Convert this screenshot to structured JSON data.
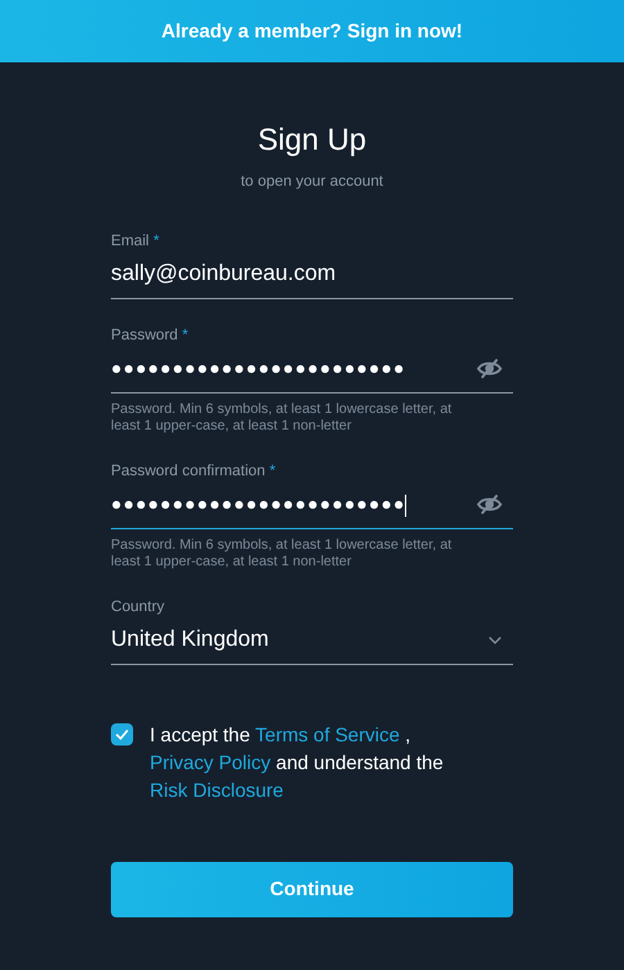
{
  "banner": {
    "text": "Already a member?",
    "link": "Sign in now!"
  },
  "title": "Sign Up",
  "subtitle": "to open your account",
  "fields": [
    {
      "kind": "text",
      "label": "Email",
      "marker": "*",
      "value": "sally@coinbureau.com",
      "focused": false
    },
    {
      "kind": "password",
      "label": "Password",
      "marker": "*",
      "value": "●●●●●●●●●●●●●●●●●●●●●●●●",
      "focused": false,
      "hint": "Password. Min 6 symbols, at least 1 lowercase letter, at least 1 upper-case, at least 1 non-letter"
    },
    {
      "kind": "password",
      "label": "Password confirmation",
      "marker": "*",
      "value": "●●●●●●●●●●●●●●●●●●●●●●●●",
      "focused": true,
      "hint": "Password. Min 6 symbols, at least 1 lowercase letter, at least 1 upper-case, at least 1 non-letter"
    },
    {
      "kind": "select",
      "label": "Country",
      "value": "United Kingdom",
      "focused": false
    }
  ],
  "terms": {
    "checked": true,
    "parts": [
      {
        "kind": "text",
        "text": "I accept the"
      },
      {
        "kind": "link",
        "text": "Terms of Service"
      },
      {
        "kind": "text",
        "text": ","
      },
      {
        "kind": "link",
        "text": "Privacy Policy"
      },
      {
        "kind": "text",
        "text": "and understand the"
      },
      {
        "kind": "link",
        "text": "Risk Disclosure"
      }
    ]
  },
  "button": "Continue"
}
